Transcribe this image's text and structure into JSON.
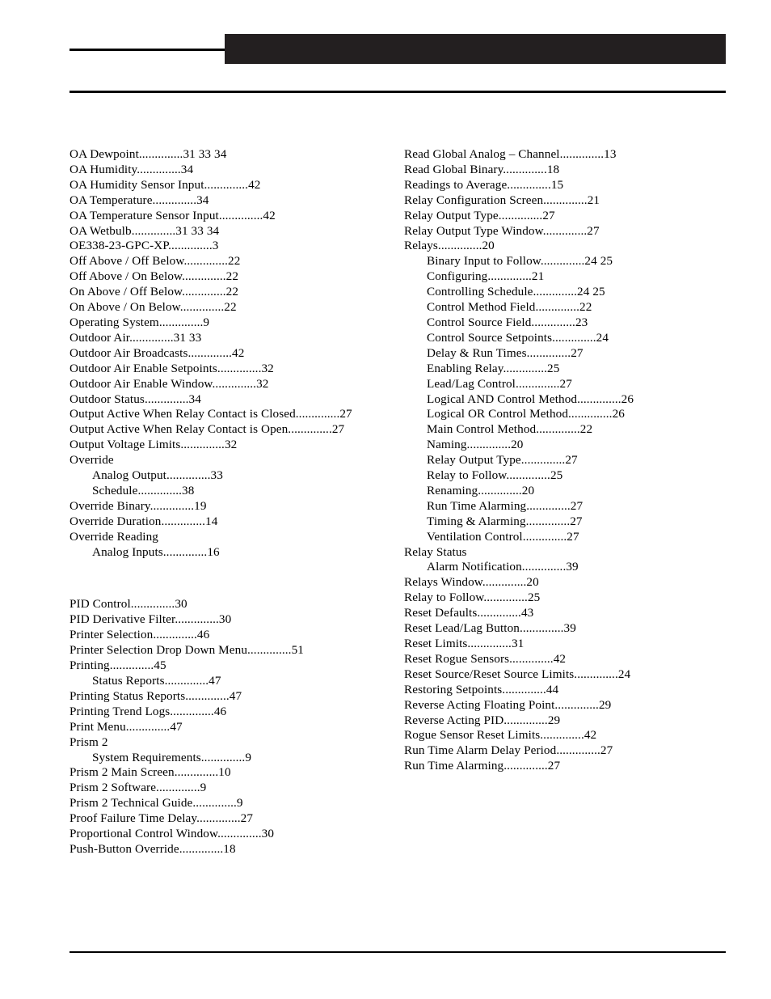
{
  "page": {
    "type": "index",
    "header": {
      "black_bar": true,
      "rules": 2
    },
    "footer": {
      "rule": true
    }
  },
  "columns": {
    "left": {
      "blocks": [
        {
          "entries": [
            {
              "text": "OA Dewpoint..............31 33 34",
              "level": 0
            },
            {
              "text": "OA Humidity..............34",
              "level": 0
            },
            {
              "text": "OA Humidity Sensor Input..............42",
              "level": 0
            },
            {
              "text": "OA Temperature..............34",
              "level": 0
            },
            {
              "text": "OA Temperature Sensor Input..............42",
              "level": 0
            },
            {
              "text": "OA Wetbulb..............31 33 34",
              "level": 0
            },
            {
              "text": "OE338-23-GPC-XP..............3",
              "level": 0
            },
            {
              "text": "Off Above / Off Below..............22",
              "level": 0
            },
            {
              "text": "Off Above / On Below..............22",
              "level": 0
            },
            {
              "text": "On Above / Off Below..............22",
              "level": 0
            },
            {
              "text": "On Above / On Below..............22",
              "level": 0
            },
            {
              "text": "Operating System..............9",
              "level": 0
            },
            {
              "text": "Outdoor Air..............31 33",
              "level": 0
            },
            {
              "text": "Outdoor Air Broadcasts..............42",
              "level": 0
            },
            {
              "text": "Outdoor Air Enable Setpoints..............32",
              "level": 0
            },
            {
              "text": "Outdoor Air Enable Window..............32",
              "level": 0
            },
            {
              "text": "Outdoor Status..............34",
              "level": 0
            },
            {
              "text": "Output Active When Relay Contact is Closed..............27",
              "level": 0
            },
            {
              "text": "Output Active When Relay Contact is Open..............27",
              "level": 0
            },
            {
              "text": "Output Voltage Limits..............32",
              "level": 0
            },
            {
              "text": "Override",
              "level": 0
            },
            {
              "text": "Analog Output..............33",
              "level": 1
            },
            {
              "text": "Schedule..............38",
              "level": 1
            },
            {
              "text": "Override Binary..............19",
              "level": 0
            },
            {
              "text": "Override Duration..............14",
              "level": 0
            },
            {
              "text": "Override Reading",
              "level": 0
            },
            {
              "text": "Analog Inputs..............16",
              "level": 1
            }
          ]
        },
        {
          "entries": [
            {
              "text": "PID Control..............30",
              "level": 0
            },
            {
              "text": "PID Derivative Filter..............30",
              "level": 0
            },
            {
              "text": "Printer Selection..............46",
              "level": 0
            },
            {
              "text": "Printer Selection Drop Down Menu..............51",
              "level": 0
            },
            {
              "text": "Printing..............45",
              "level": 0
            },
            {
              "text": "Status Reports..............47",
              "level": 1
            },
            {
              "text": "Printing Status Reports..............47",
              "level": 0
            },
            {
              "text": "Printing Trend Logs..............46",
              "level": 0
            },
            {
              "text": "Print Menu..............47",
              "level": 0
            },
            {
              "text": "Prism 2",
              "level": 0
            },
            {
              "text": "System Requirements..............9",
              "level": 1
            },
            {
              "text": "Prism 2 Main Screen..............10",
              "level": 0
            },
            {
              "text": "Prism 2 Software..............9",
              "level": 0
            },
            {
              "text": "Prism 2 Technical Guide..............9",
              "level": 0
            },
            {
              "text": "Proof Failure Time Delay..............27",
              "level": 0
            },
            {
              "text": "Proportional Control Window..............30",
              "level": 0
            },
            {
              "text": "Push-Button Override..............18",
              "level": 0
            }
          ]
        }
      ]
    },
    "right": {
      "blocks": [
        {
          "entries": [
            {
              "text": "Read Global Analog – Channel..............13",
              "level": 0
            },
            {
              "text": "Read Global Binary..............18",
              "level": 0
            },
            {
              "text": "Readings to Average..............15",
              "level": 0
            },
            {
              "text": "Relay Configuration Screen..............21",
              "level": 0
            },
            {
              "text": "Relay Output Type..............27",
              "level": 0
            },
            {
              "text": "Relay Output Type Window..............27",
              "level": 0
            },
            {
              "text": "Relays..............20",
              "level": 0
            },
            {
              "text": "Binary Input to Follow..............24 25",
              "level": 1
            },
            {
              "text": "Configuring..............21",
              "level": 1
            },
            {
              "text": "Controlling Schedule..............24 25",
              "level": 1
            },
            {
              "text": "Control Method Field..............22",
              "level": 1
            },
            {
              "text": "Control Source Field..............23",
              "level": 1
            },
            {
              "text": "Control Source Setpoints..............24",
              "level": 1
            },
            {
              "text": "Delay & Run Times..............27",
              "level": 1
            },
            {
              "text": "Enabling Relay..............25",
              "level": 1
            },
            {
              "text": "Lead/Lag Control..............27",
              "level": 1
            },
            {
              "text": "Logical AND Control Method..............26",
              "level": 1
            },
            {
              "text": "Logical OR Control Method..............26",
              "level": 1
            },
            {
              "text": "Main Control Method..............22",
              "level": 1
            },
            {
              "text": "Naming..............20",
              "level": 1
            },
            {
              "text": "Relay Output Type..............27",
              "level": 1
            },
            {
              "text": "Relay to Follow..............25",
              "level": 1
            },
            {
              "text": "Renaming..............20",
              "level": 1
            },
            {
              "text": "Run Time Alarming..............27",
              "level": 1
            },
            {
              "text": "Timing & Alarming..............27",
              "level": 1
            },
            {
              "text": "Ventilation Control..............27",
              "level": 1
            },
            {
              "text": "Relay Status",
              "level": 0
            },
            {
              "text": "Alarm Notification..............39",
              "level": 1
            },
            {
              "text": "Relays Window..............20",
              "level": 0
            },
            {
              "text": "Relay to Follow..............25",
              "level": 0
            },
            {
              "text": "Reset Defaults..............43",
              "level": 0
            },
            {
              "text": "Reset Lead/Lag Button..............39",
              "level": 0
            },
            {
              "text": "Reset Limits..............31",
              "level": 0
            },
            {
              "text": "Reset Rogue Sensors..............42",
              "level": 0
            },
            {
              "text": "Reset Source/Reset Source Limits..............24",
              "level": 0
            },
            {
              "text": "Restoring Setpoints..............44",
              "level": 0
            },
            {
              "text": "Reverse Acting Floating Point..............29",
              "level": 0
            },
            {
              "text": "Reverse Acting PID..............29",
              "level": 0
            },
            {
              "text": "Rogue Sensor Reset Limits..............42",
              "level": 0
            },
            {
              "text": "Run Time Alarm Delay Period..............27",
              "level": 0
            },
            {
              "text": "Run Time Alarming..............27",
              "level": 0
            }
          ]
        }
      ]
    }
  }
}
